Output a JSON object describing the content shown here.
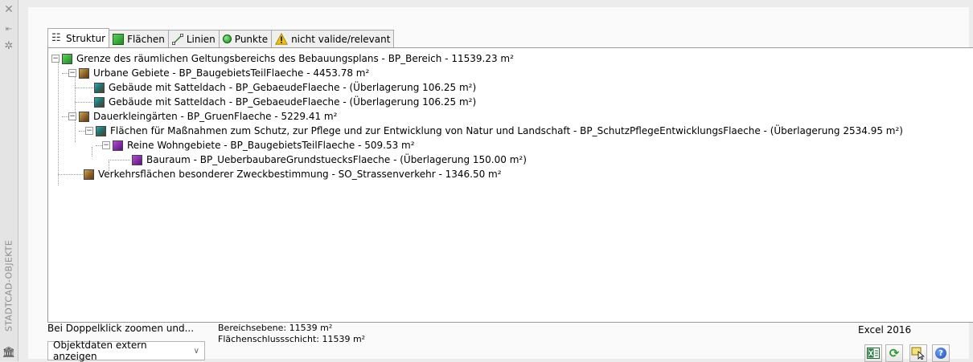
{
  "sidebar": {
    "close_icon": "close-icon",
    "pin_icon": "auto-hide-icon",
    "settings_icon": "settings-icon",
    "title": "STADTCAD-OBJEKTE",
    "bottom_icon": "building-icon"
  },
  "tabs": [
    {
      "label": "Struktur",
      "icon": "tree-icon",
      "active": true
    },
    {
      "label": "Flächen",
      "icon": "green-square-icon",
      "active": false
    },
    {
      "label": "Linien",
      "icon": "line-icon",
      "active": false
    },
    {
      "label": "Punkte",
      "icon": "point-icon",
      "active": false
    },
    {
      "label": "nicht valide/relevant",
      "icon": "warning-icon",
      "active": false
    }
  ],
  "tree": [
    {
      "text": "Grenze des räumlichen Geltungsbereichs des Bebauungsplans - BP_Bereich -  11539.23 m²",
      "level": 0,
      "icon_color": "green",
      "expanded": true
    },
    {
      "text": "Urbane Gebiete - BP_BaugebietsTeilFlaeche -  4453.78 m²",
      "level": 1,
      "icon_color": "brown",
      "expanded": true
    },
    {
      "text": "Gebäude mit Satteldach - BP_GebaeudeFlaeche -  (Überlagerung 106.25 m²)",
      "level": 2,
      "icon_color": "teal",
      "expanded": null
    },
    {
      "text": "Gebäude mit Satteldach - BP_GebaeudeFlaeche -  (Überlagerung 106.25 m²)",
      "level": 2,
      "icon_color": "teal",
      "expanded": null
    },
    {
      "text": "Dauerkleingärten - BP_GruenFlaeche -  5229.41 m²",
      "level": 1,
      "icon_color": "brown",
      "expanded": true
    },
    {
      "text": "Flächen für Maßnahmen zum Schutz, zur Pflege und zur Entwicklung von Natur und Landschaft - BP_SchutzPflegeEntwicklungsFlaeche -  (Überlagerung 2534.95 m²)",
      "level": 2,
      "icon_color": "teal",
      "expanded": true
    },
    {
      "text": "Reine Wohngebiete - BP_BaugebietsTeilFlaeche -  509.53 m²",
      "level": 3,
      "icon_color": "purple",
      "expanded": true
    },
    {
      "text": "Bauraum - BP_UeberbaubareGrundstuecksFlaeche -  (Überlagerung 150.00 m²)",
      "level": 4,
      "icon_color": "purple",
      "expanded": null
    },
    {
      "text": "Verkehrsflächen besonderer Zweckbestimmung - SO_Strassenverkehr -  1346.50 m²",
      "level": 1,
      "icon_color": "brown",
      "expanded": null
    }
  ],
  "footer": {
    "doubleclick_label": "Bei Doppelklick zoomen und...",
    "select_value": "Objektdaten extern anzeigen",
    "bereichsebene": "Bereichsebene: 11539 m²",
    "flaechenschluss": "Flächenschlussschicht: 11539 m²",
    "excel_label": "Excel 2016"
  },
  "toolbar": {
    "buttons": [
      {
        "name": "excel-export-button",
        "icon": "excel-icon"
      },
      {
        "name": "refresh-button",
        "icon": "refresh-icon"
      },
      {
        "name": "select-objects-button",
        "icon": "select-icon"
      },
      {
        "name": "help-button",
        "icon": "help-icon"
      }
    ]
  }
}
